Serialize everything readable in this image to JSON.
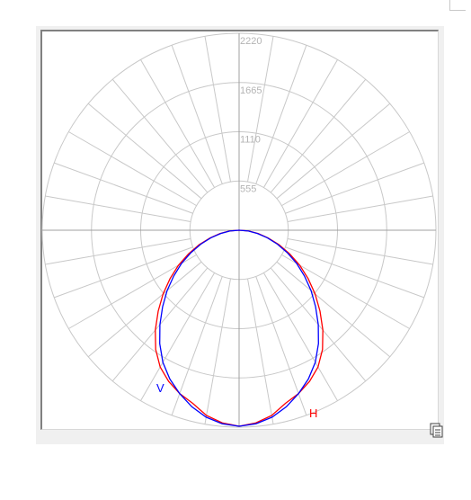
{
  "chart_data": {
    "type": "polar",
    "title": "",
    "radial_ticks": [
      "555",
      "1110",
      "1665",
      "2220"
    ],
    "rmax": 2220,
    "angle_step_deg": 10,
    "grid": true,
    "colors": {
      "grid": "#c8c8c8",
      "axis": "#a0a0a0",
      "H": "#ff0000",
      "V": "#0000ff"
    },
    "series": [
      {
        "name": "H",
        "angles": [
          0,
          5,
          10,
          15,
          20,
          25,
          30,
          35,
          40,
          45,
          50,
          55,
          60,
          65,
          70,
          75,
          80,
          85,
          90
        ],
        "values": [
          2210,
          2180,
          2120,
          2020,
          1960,
          1880,
          1780,
          1640,
          1470,
          1290,
          1120,
          950,
          790,
          630,
          480,
          340,
          220,
          110,
          0
        ]
      },
      {
        "name": "V",
        "angles": [
          0,
          5,
          10,
          15,
          20,
          25,
          30,
          35,
          40,
          45,
          50,
          55,
          60,
          65,
          70,
          75,
          80,
          85,
          90
        ],
        "values": [
          2210,
          2190,
          2140,
          2060,
          1960,
          1850,
          1720,
          1560,
          1390,
          1220,
          1060,
          900,
          750,
          600,
          460,
          330,
          210,
          105,
          0
        ]
      }
    ]
  },
  "icons": {
    "corner": "copy-icon"
  }
}
